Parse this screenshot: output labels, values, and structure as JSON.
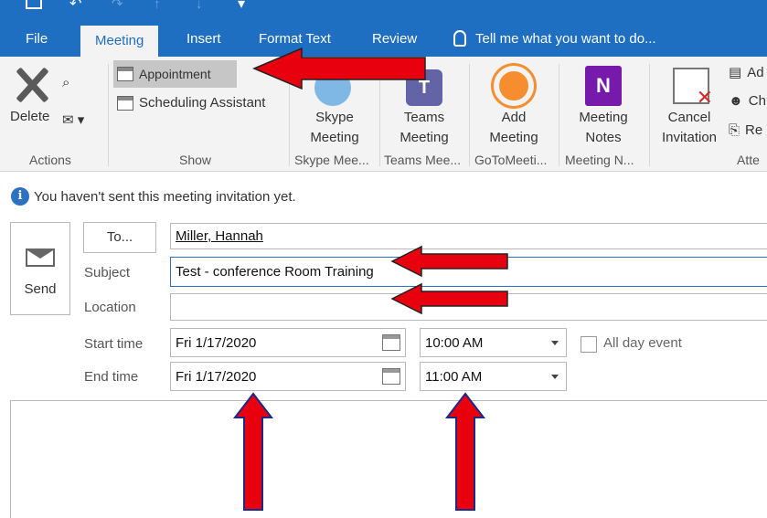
{
  "tabs": {
    "file": "File",
    "meeting": "Meeting",
    "insert": "Insert",
    "format_text": "Format Text",
    "review": "Review",
    "tell_me": "Tell me what you want to do..."
  },
  "ribbon": {
    "actions": {
      "delete_label": "Delete",
      "group_label": "Actions"
    },
    "show": {
      "appointment_label": "Appointment",
      "scheduling_label": "Scheduling Assistant",
      "group_label": "Show"
    },
    "skype": {
      "button_line1": "Skype",
      "button_line2": "Meeting",
      "group_label": "Skype Mee..."
    },
    "teams": {
      "button_line1": "Teams",
      "button_line2": "Meeting",
      "group_label": "Teams Mee..."
    },
    "goto": {
      "button_line1": "Add",
      "button_line2": "Meeting",
      "group_label": "GoToMeeti..."
    },
    "onenote": {
      "button_line1": "Meeting",
      "button_line2": "Notes",
      "group_label": "Meeting N..."
    },
    "attendees": {
      "cancel_line1": "Cancel",
      "cancel_line2": "Invitation",
      "item1": "Ad",
      "item2": "Ch",
      "item3": "Re",
      "group_label": "Atte"
    }
  },
  "info": {
    "message": "You haven't sent this meeting invitation yet."
  },
  "form": {
    "send_label": "Send",
    "to_button": "To...",
    "to_value": "Miller, Hannah",
    "subject_label": "Subject",
    "subject_value": "Test - conference Room Training",
    "location_label": "Location",
    "location_value": "",
    "start_label": "Start time",
    "start_date": "Fri 1/17/2020",
    "start_time": "10:00 AM",
    "all_day_label": "All day event",
    "all_day_checked": false,
    "end_label": "End time",
    "end_date": "Fri 1/17/2020",
    "end_time": "11:00 AM"
  },
  "colors": {
    "accent": "#1e6fc2",
    "annotation_arrow": "#e8000f"
  }
}
